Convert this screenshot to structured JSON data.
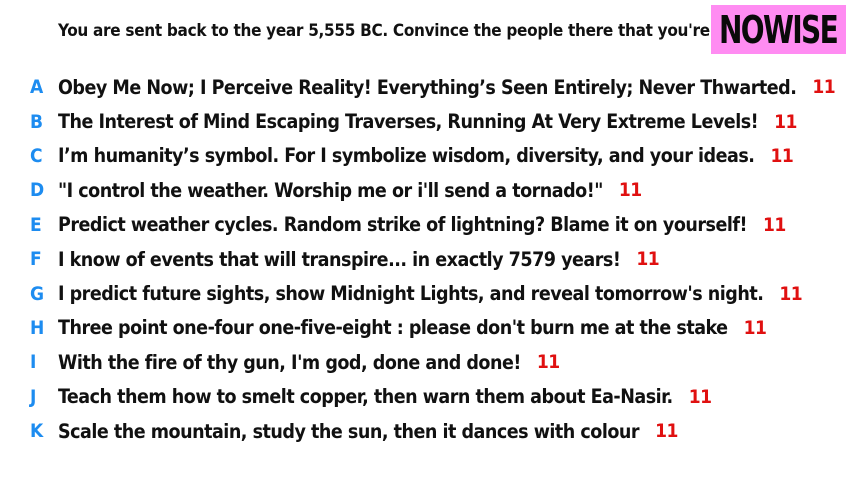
{
  "prompt": "You are sent back to the year 5,555 BC. Convince the people there that you're a god.",
  "logo": "NOWISE",
  "colors": {
    "letter": "#1d8cf0",
    "score": "#e01010",
    "logo_bg": "#ff8cf2"
  },
  "answers": [
    {
      "letter": "A",
      "text": "Obey Me Now; I Perceive Reality! Everything’s Seen Entirely; Never Thwarted.",
      "score": "11"
    },
    {
      "letter": "B",
      "text": "The Interest of Mind Escaping Traverses, Running At Very Extreme Levels!",
      "score": "11"
    },
    {
      "letter": "C",
      "text": "I’m humanity’s symbol. For I symbolize wisdom, diversity, and your ideas.",
      "score": "11"
    },
    {
      "letter": "D",
      "text": "\"I control the weather. Worship me or i'll send a tornado!\"",
      "score": "11"
    },
    {
      "letter": "E",
      "text": "Predict weather cycles. Random strike of lightning? Blame it on yourself!",
      "score": "11"
    },
    {
      "letter": "F",
      "text": "I know of events that will transpire... in exactly 7579 years!",
      "score": "11"
    },
    {
      "letter": "G",
      "text": "I predict future sights, show Midnight Lights, and reveal tomorrow's night.",
      "score": "11"
    },
    {
      "letter": "H",
      "text": "Three point one-four one-five-eight : please don't burn me at the stake",
      "score": "11"
    },
    {
      "letter": "I",
      "text": "With the fire of thy gun, I'm god, done and done!",
      "score": "11"
    },
    {
      "letter": "J",
      "text": "Teach them how to smelt copper, then warn them about Ea-Nasir.",
      "score": "11"
    },
    {
      "letter": "K",
      "text": "Scale the mountain, study the sun, then it dances with colour",
      "score": "11"
    }
  ]
}
